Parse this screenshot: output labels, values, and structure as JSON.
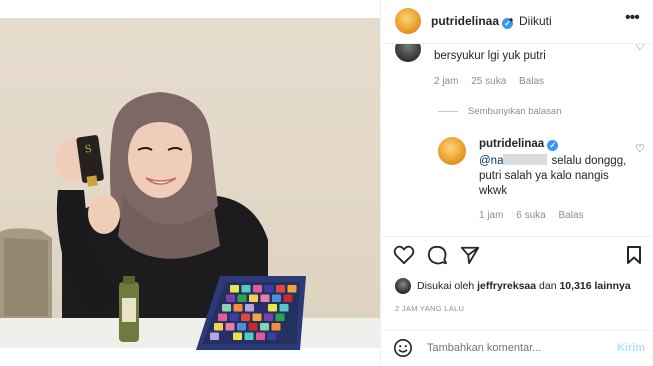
{
  "header": {
    "username": "putridelinaa",
    "separator": "•",
    "follow_status": "Diikuti",
    "more": "•••"
  },
  "comments": {
    "first": {
      "text": "bersyukur lgi yuk putri",
      "time": "2 jam",
      "likes": "25 suka",
      "reply": "Balas"
    },
    "hide_replies": "Sembunyikan balasan",
    "reply": {
      "username": "putridelinaa",
      "mention": "@na",
      "text": "selalu donggg, putri salah ya kalo nangis wkwk",
      "time": "1 jam",
      "likes": "6 suka",
      "reply": "Balas"
    }
  },
  "likes": {
    "prefix": "Disukai oleh",
    "user": "jeffryreksaa",
    "connector": "dan",
    "count": "10,316 lainnya"
  },
  "timestamp": "2 JAM YANG LALU",
  "composer": {
    "placeholder": "Tambahkan komentar...",
    "post": "Kirim"
  },
  "palette_colors": [
    "#e7e64a",
    "#56c9c0",
    "#e35aa0",
    "#3a3f9e",
    "#e14640",
    "#f0a63a",
    "#7a3fa8",
    "#2ea34d",
    "#f4d34a",
    "#e87faa",
    "#4b8fd9",
    "#c52d2d",
    "#8fd1a8",
    "#f38c3c",
    "#b6a3e0",
    "#2b2b6e"
  ]
}
